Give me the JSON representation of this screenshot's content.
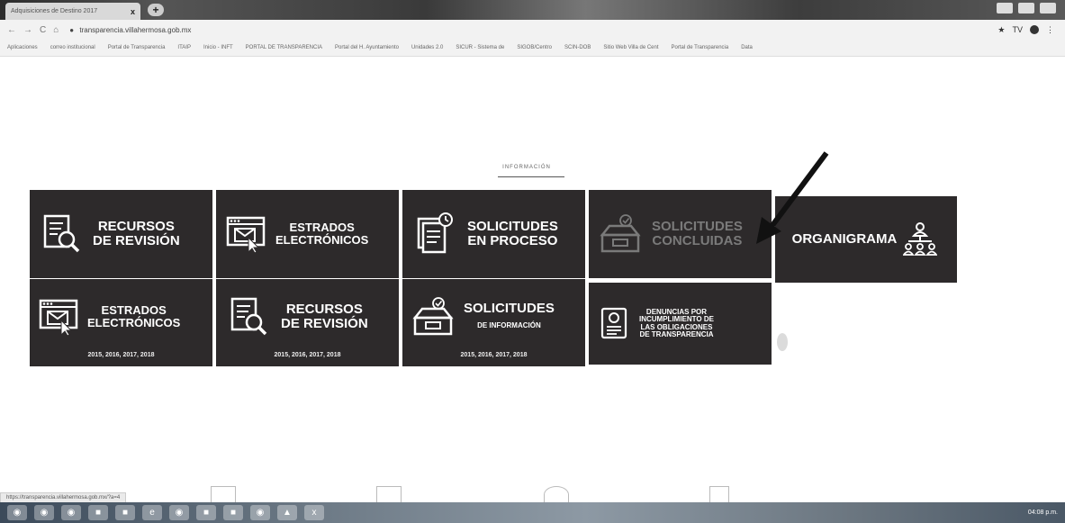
{
  "browser": {
    "tab_title": "Adquisiciones de Destino 2017",
    "tab_close": "x",
    "new_tab": "+",
    "url": "transparencia.villahermosa.gob.mx",
    "nav": [
      "←",
      "→",
      "C",
      "⌂"
    ],
    "bookmarks": [
      "Aplicaciones",
      "correo institucional",
      "Portal de Transparencia",
      "ITAIP",
      "Inicio - INFT",
      "PORTAL DE TRANSPARENCIA",
      "Portal del H. Ayuntamiento",
      "Unidades 2.0",
      "SICUR - Sistema de",
      "SIGOB/Centro",
      "SCIN-DOB",
      "Sitio Web Villa de Cent",
      "Portal de Transparencia",
      "Data"
    ],
    "profile_initial": "TV"
  },
  "page": {
    "section_label": "INFORMACIÓN",
    "tiles_row1": [
      {
        "line1": "RECURSOS",
        "line2": "DE REVISIÓN",
        "icon": "document-search-icon"
      },
      {
        "line1": "ESTRADOS",
        "line2": "ELECTRÓNICOS",
        "icon": "mail-window-icon"
      },
      {
        "line1": "SOLICITUDES",
        "line2": "EN PROCESO",
        "icon": "documents-clock-icon"
      },
      {
        "line1": "SOLICITUDES",
        "line2": "CONCLUIDAS",
        "icon": "inbox-check-icon"
      },
      {
        "line1": "ORGANIGRAMA",
        "line2": "",
        "icon": "org-chart-icon"
      }
    ],
    "tiles_row2": [
      {
        "line1": "ESTRADOS",
        "line2": "ELECTRÓNICOS",
        "years": "2015, 2016, 2017, 2018",
        "icon": "mail-window-icon"
      },
      {
        "line1": "RECURSOS",
        "line2": "DE REVISIÓN",
        "years": "2015, 2016, 2017, 2018",
        "icon": "document-search-icon"
      },
      {
        "line1": "SOLICITUDES",
        "line2": "DE INFORMACIÓN",
        "years": "2015, 2016, 2017, 2018",
        "icon": "inbox-check-icon"
      },
      {
        "line1": "DENUNCIAS POR",
        "line2": "INCUMPLIMIENTO DE",
        "line3": "LAS OBLIGACIONES",
        "line4": "DE TRANSPARENCIA",
        "icon": "certificate-icon"
      }
    ]
  },
  "status": {
    "hover_url": "https://transparencia.villahermosa.gob.mx/?a=4"
  },
  "taskbar": {
    "clock": "04:08 p.m."
  },
  "colors": {
    "tile_bg": "#2d2a2b",
    "tile_text": "#ffffff",
    "faded_text": "#7a7a7a"
  }
}
